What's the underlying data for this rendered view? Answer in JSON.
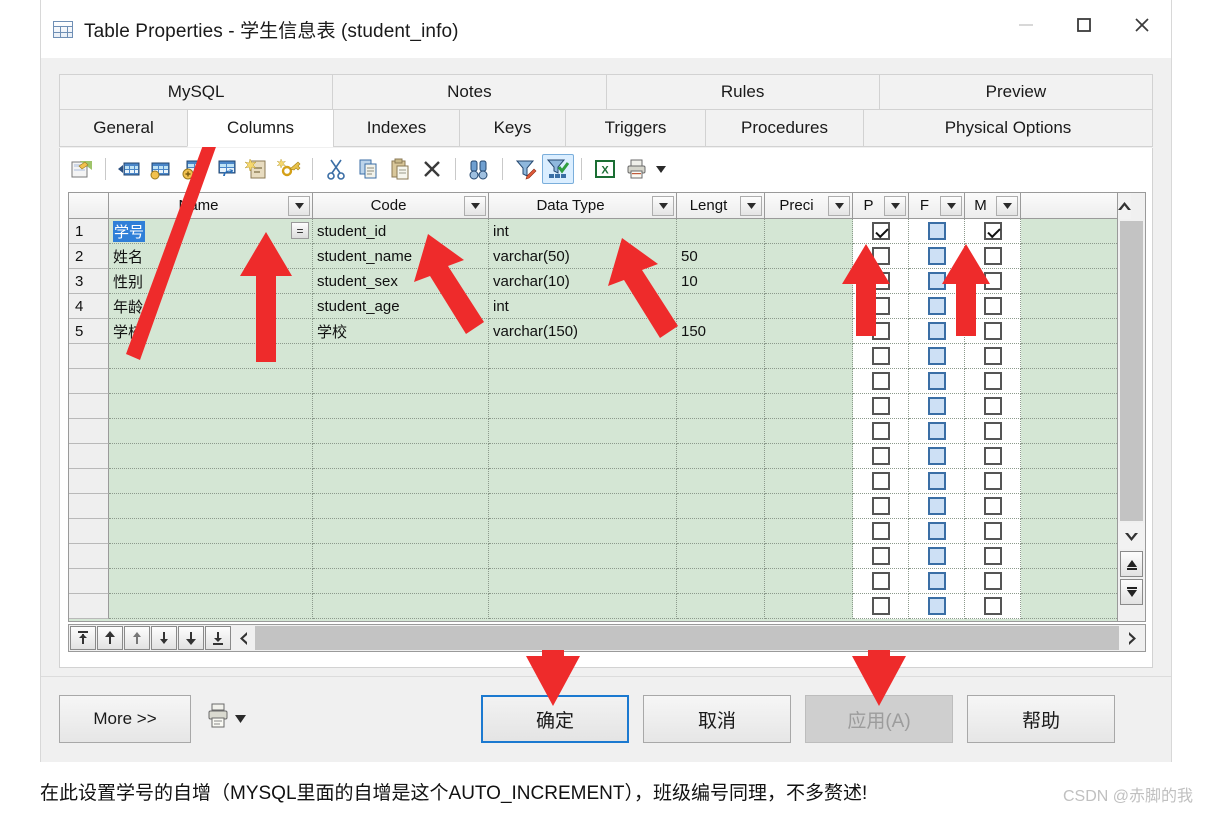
{
  "window": {
    "title": "Table Properties - 学生信息表 (student_info)",
    "icon": "table-icon",
    "controls": {
      "minimize": "—",
      "maximize": "□",
      "close": "✕"
    }
  },
  "tabs": {
    "top_row": [
      {
        "label": "MySQL",
        "active": false
      },
      {
        "label": "Notes",
        "active": false
      },
      {
        "label": "Rules",
        "active": false
      },
      {
        "label": "Preview",
        "active": false
      }
    ],
    "bottom_row": [
      {
        "label": "General",
        "active": false
      },
      {
        "label": "Columns",
        "active": true
      },
      {
        "label": "Indexes",
        "active": false
      },
      {
        "label": "Keys",
        "active": false
      },
      {
        "label": "Triggers",
        "active": false
      },
      {
        "label": "Procedures",
        "active": false
      },
      {
        "label": "Physical Options",
        "active": false
      }
    ]
  },
  "toolbar": {
    "items": [
      {
        "name": "properties-icon",
        "selected": false
      },
      {
        "name": "insert-column-icon",
        "selected": false
      },
      {
        "name": "add-column-icon",
        "selected": false
      },
      {
        "name": "add-table-icon",
        "selected": false
      },
      {
        "name": "replicate-table-icon",
        "selected": false
      },
      {
        "name": "new-note-icon",
        "selected": false
      },
      {
        "name": "new-key-icon",
        "selected": false
      },
      {
        "name": "cut-icon",
        "selected": false
      },
      {
        "name": "copy-icon",
        "selected": false
      },
      {
        "name": "paste-icon",
        "selected": false
      },
      {
        "name": "delete-icon",
        "selected": false
      },
      {
        "name": "find-icon",
        "selected": false
      },
      {
        "name": "edit-filter-icon",
        "selected": false
      },
      {
        "name": "apply-filter-icon",
        "selected": true
      },
      {
        "name": "export-excel-icon",
        "selected": false
      },
      {
        "name": "print-icon",
        "selected": false
      }
    ]
  },
  "grid": {
    "headers": [
      "",
      "Name",
      "Code",
      "Data Type",
      "Lengt",
      "Preci",
      "P",
      "F",
      "M"
    ],
    "rows": [
      {
        "num": "1",
        "name": "学号",
        "code": "student_id",
        "data_type": "int",
        "length": "",
        "precision": "",
        "p": true,
        "f": false,
        "m": true,
        "selected_name": true,
        "has_eq_button": true
      },
      {
        "num": "2",
        "name": "姓名",
        "code": "student_name",
        "data_type": "varchar(50)",
        "length": "50",
        "precision": "",
        "p": false,
        "f": false,
        "m": false,
        "selected_name": false,
        "has_eq_button": false
      },
      {
        "num": "3",
        "name": "性别",
        "code": "student_sex",
        "data_type": "varchar(10)",
        "length": "10",
        "precision": "",
        "p": false,
        "f": false,
        "m": false,
        "selected_name": false,
        "has_eq_button": false
      },
      {
        "num": "4",
        "name": "年龄",
        "code": "student_age",
        "data_type": "int",
        "length": "",
        "precision": "",
        "p": false,
        "f": false,
        "m": false,
        "selected_name": false,
        "has_eq_button": false
      },
      {
        "num": "5",
        "name": "学校",
        "code": "学校",
        "data_type": "varchar(150)",
        "length": "150",
        "precision": "",
        "p": false,
        "f": false,
        "m": false,
        "selected_name": false,
        "has_eq_button": false
      }
    ],
    "empty_row_count": 11,
    "eq_button_label": "="
  },
  "nav": {
    "buttons": [
      "first-record-button",
      "previous-page-button",
      "previous-record-button",
      "next-record-button",
      "next-page-button",
      "last-record-button"
    ]
  },
  "footer": {
    "more_label": "More >>",
    "print_icon": "print-preview-icon",
    "ok_label": "确定",
    "cancel_label": "取消",
    "apply_label": "应用(A)",
    "help_label": "帮助",
    "apply_disabled": true,
    "ok_focused": true
  },
  "annotation": {
    "caption": "在此设置学号的自增（MYSQL里面的自增是这个AUTO_INCREMENT），班级编号同理，不多赘述!",
    "watermark": "CSDN @赤脚的我",
    "arrow_color": "#ee2b2b",
    "arrow_count": 5
  },
  "colors": {
    "grid_green": "#d4e6d4",
    "selection_blue": "#2f7fd8",
    "focus_blue": "#1b79d0",
    "disabled_gray": "#cfcfcf"
  }
}
